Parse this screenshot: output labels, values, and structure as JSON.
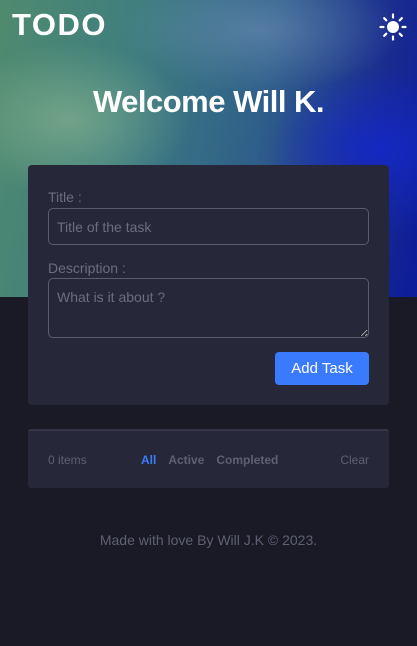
{
  "header": {
    "logo": "TODO",
    "theme_icon": "sun-icon",
    "welcome": "Welcome Will K."
  },
  "form": {
    "title_label": "Title :",
    "title_placeholder": "Title of the task",
    "title_value": "",
    "description_label": "Description :",
    "description_placeholder": "What is it about ?",
    "description_value": "",
    "add_button": "Add Task"
  },
  "task_footer": {
    "items_count": "0 items",
    "filters": [
      {
        "label": "All",
        "active": true
      },
      {
        "label": "Active",
        "active": false
      },
      {
        "label": "Completed",
        "active": false
      }
    ],
    "clear": "Clear"
  },
  "credit": "Made with love By Will J.K © 2023.",
  "colors": {
    "accent": "#3a7bfd",
    "background": "#1a1a26",
    "card": "#262738",
    "muted_text": "#5e6074"
  }
}
